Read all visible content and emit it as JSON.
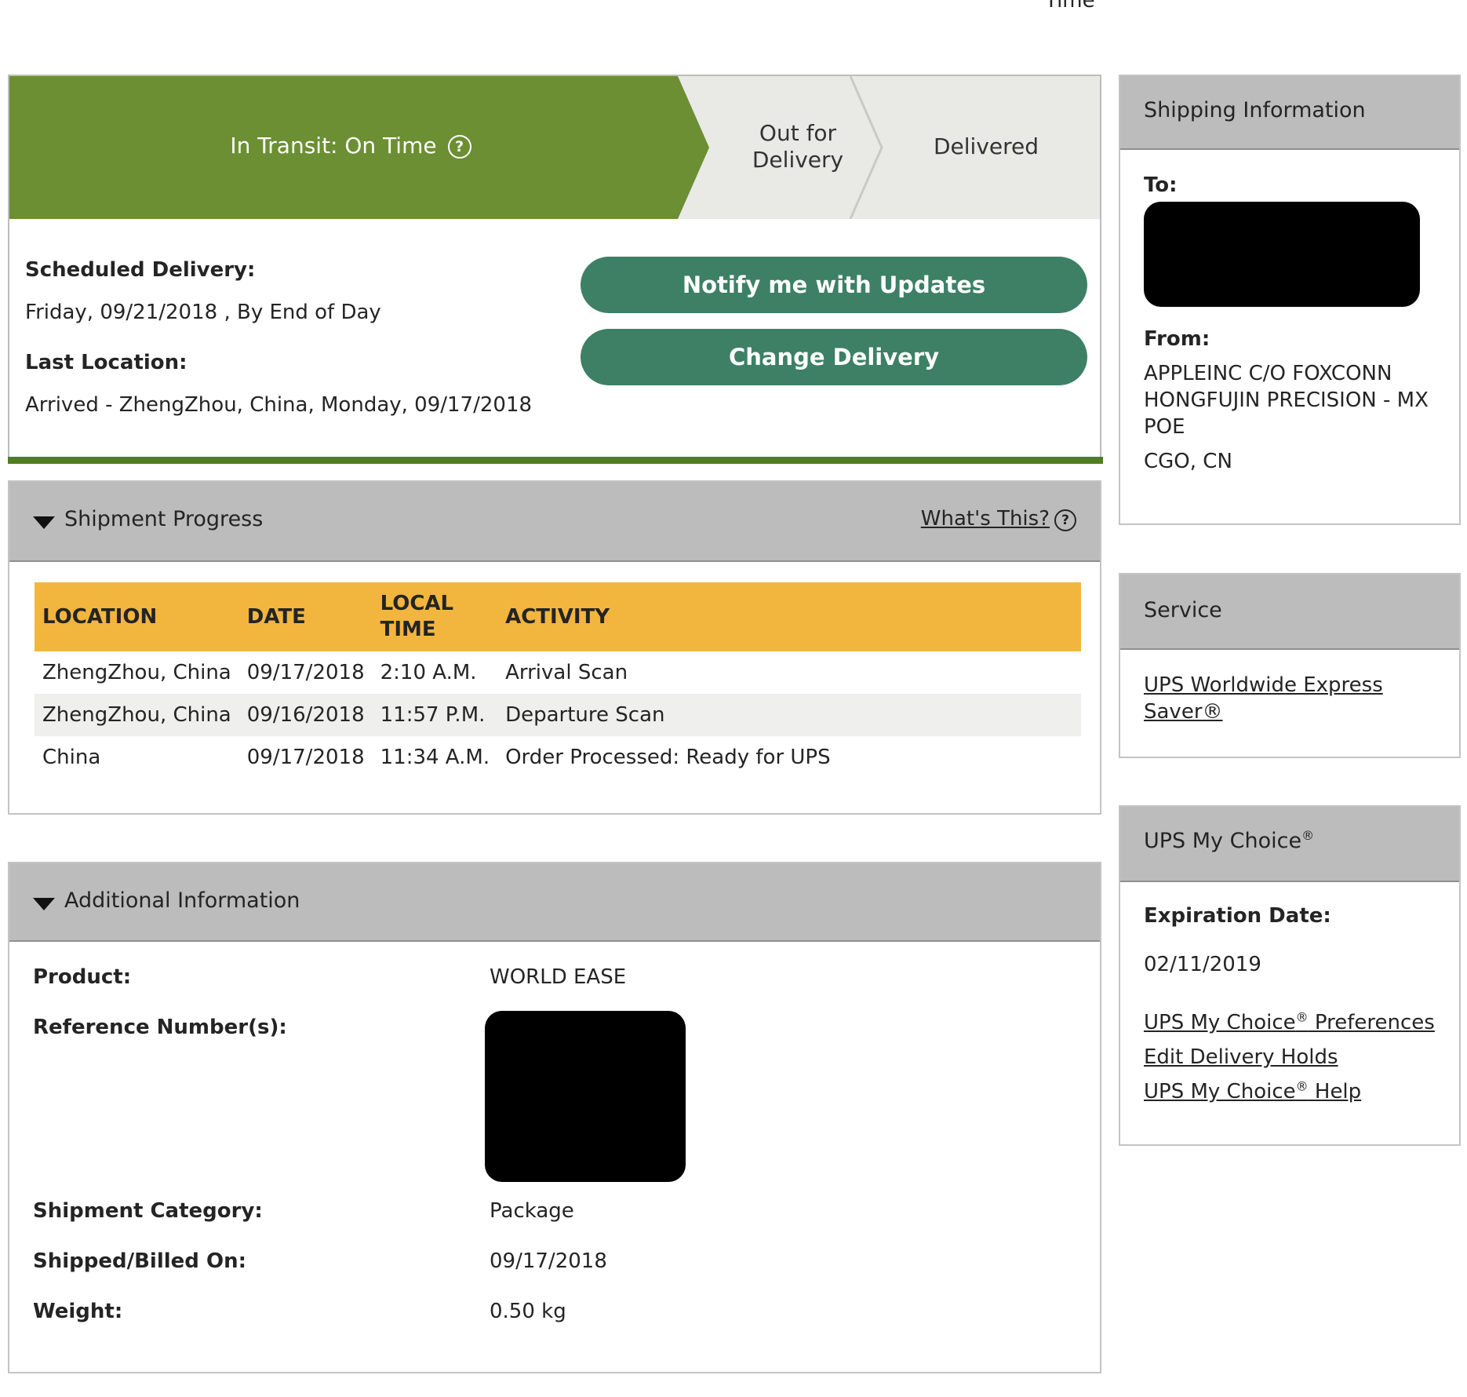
{
  "top_cut_text": "Time",
  "status": {
    "current": "In Transit: On Time",
    "help_icon": "question-circle-icon",
    "stage_out": "Out for Delivery",
    "stage_delivered": "Delivered",
    "colors": {
      "progress": "#6b8f32",
      "inactive": "#e9e9e6",
      "button": "#3d8066"
    }
  },
  "delivery": {
    "scheduled_label": "Scheduled Delivery:",
    "scheduled_value": "Friday, 09/21/2018 , By End of Day",
    "last_location_label": "Last Location:",
    "last_location_value": "Arrived - ZhengZhou, China, Monday, 09/17/2018",
    "notify_button": "Notify me with Updates",
    "change_button": "Change Delivery"
  },
  "progress": {
    "title": "Shipment Progress",
    "whats_this": "What's This?",
    "columns": [
      "LOCATION",
      "DATE",
      "LOCAL TIME",
      "ACTIVITY"
    ],
    "rows": [
      {
        "location": "ZhengZhou,  China",
        "date": "09/17/2018",
        "time": "2:10 A.M.",
        "activity": "Arrival Scan"
      },
      {
        "location": "ZhengZhou,  China",
        "date": "09/16/2018",
        "time": "11:57 P.M.",
        "activity": "Departure Scan"
      },
      {
        "location": "China",
        "date": "09/17/2018",
        "time": "11:34 A.M.",
        "activity": "Order Processed: Ready for UPS"
      }
    ]
  },
  "additional": {
    "title": "Additional Information",
    "product_label": "Product:",
    "product_value": "WORLD EASE",
    "reference_label": "Reference Number(s):",
    "category_label": "Shipment Category:",
    "category_value": "Package",
    "billed_label": "Shipped/Billed On:",
    "billed_value": "09/17/2018",
    "weight_label": "Weight:",
    "weight_value": "0.50 kg"
  },
  "shipping": {
    "title": "Shipping Information",
    "to_label": "To:",
    "from_label": "From:",
    "from_line1": "APPLEINC C/O FOXCONN",
    "from_line2": "HONGFUJIN PRECISION - MX",
    "from_line3": "POE",
    "from_city": "CGO,  CN"
  },
  "service": {
    "title": "Service",
    "link_line1": "UPS Worldwide Express",
    "link_line2": "Saver®"
  },
  "mychoice": {
    "title": "UPS My Choice",
    "reg": "®",
    "exp_label": "Expiration Date:",
    "exp_value": "02/11/2019",
    "pref_link_a": "UPS My Choice",
    "pref_link_b": " Preferences",
    "holds_link": "Edit Delivery Holds",
    "help_link_a": "UPS My Choice",
    "help_link_b": " Help"
  }
}
